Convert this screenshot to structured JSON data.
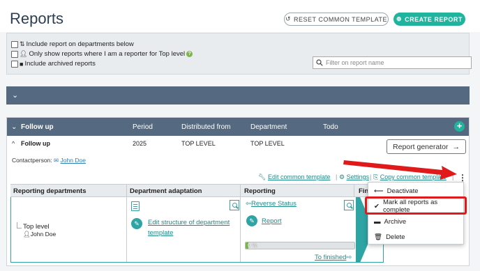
{
  "header": {
    "title": "Reports",
    "reset_label": "RESET COMMON TEMPLATE",
    "create_label": "CREATE REPORT"
  },
  "filters": {
    "include_departments": "Include report on departments below",
    "only_reporter": "Only show reports where I am a reporter for Top level",
    "include_archived": "Include archived reports",
    "search_placeholder": "Filter on report name"
  },
  "card": {
    "header": {
      "title": "Follow up",
      "period": "Period",
      "distributed": "Distributed from",
      "department": "Department",
      "todo": "Todo"
    },
    "row": {
      "title": "Follow up",
      "period": "2025",
      "distributed": "TOP LEVEL",
      "department": "TOP LEVEL"
    },
    "generator_label": "Report generator",
    "contact_label": "Contactperson:",
    "contact_name": "John Doe",
    "actions": {
      "edit_template": "Edit common template",
      "settings": "Settings",
      "copy_template": "Copy common template"
    },
    "table": {
      "col_departments": "Reporting departments",
      "col_adaptation": "Department adaptation",
      "col_reporting": "Reporting",
      "col_finished": "Finis",
      "department_name": "Top level",
      "department_person": "John Doe",
      "edit_structure": "Edit structure of department template",
      "reverse_status": "Reverse Status",
      "report_link": "Report",
      "progress": 0,
      "progress_label": "0 %",
      "to_finished": "To finished"
    }
  },
  "dropdown": {
    "items": [
      {
        "label": "Deactivate",
        "icon": "arrow-left-icon"
      },
      {
        "label": "Mark all reports as complete",
        "icon": "check-icon"
      },
      {
        "label": "Archive",
        "icon": "folder-icon"
      },
      {
        "label": "Delete",
        "icon": "trash-icon"
      }
    ]
  },
  "colors": {
    "accent": "#20b39e",
    "bar": "#556a80",
    "highlight": "#e0191a"
  }
}
